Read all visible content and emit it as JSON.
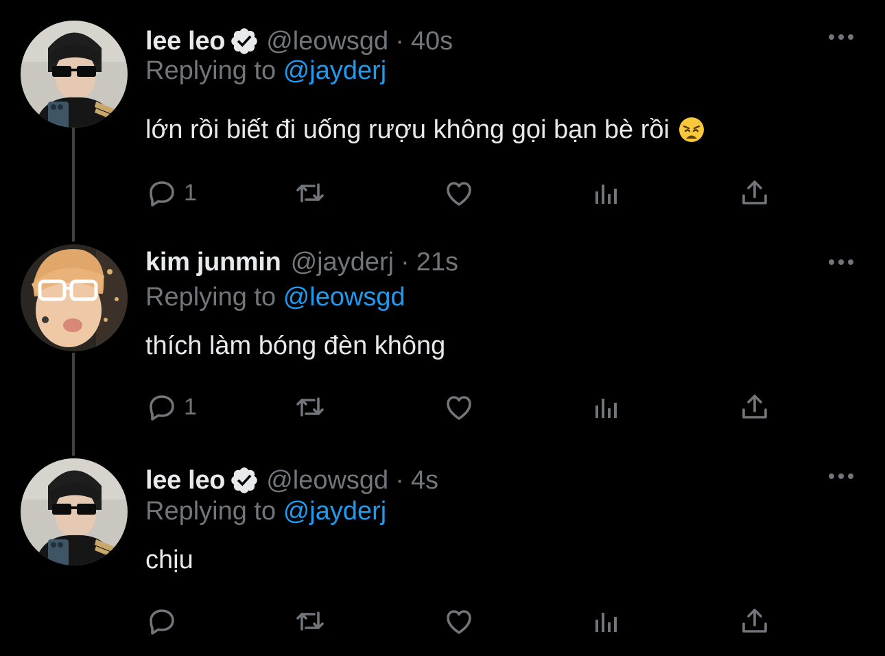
{
  "colors": {
    "background": "#000000",
    "primary_text": "#e7e9ea",
    "secondary_text": "#71767b",
    "accent": "#1d9bf0",
    "thread_line": "#3e4144"
  },
  "tweets": [
    {
      "display_name": "lee leo",
      "verified": true,
      "handle": "@leowsgd",
      "separator": "·",
      "time": "40s",
      "replying_prefix": "Replying to",
      "replying_to": "@jayderj",
      "text": "lớn rồi biết đi uống rượu không gọi bạn bè rồi",
      "emoji": "weary-face-emoji",
      "reply_count": "1",
      "icons": [
        "reply-icon",
        "retweet-icon",
        "like-icon",
        "views-icon",
        "share-icon",
        "more-icon"
      ]
    },
    {
      "display_name": "kim junmin",
      "verified": false,
      "handle": "@jayderj",
      "separator": "·",
      "time": "21s",
      "replying_prefix": "Replying to",
      "replying_to": "@leowsgd",
      "text": "thích làm bóng đèn không",
      "reply_count": "1",
      "icons": [
        "reply-icon",
        "retweet-icon",
        "like-icon",
        "views-icon",
        "share-icon",
        "more-icon"
      ]
    },
    {
      "display_name": "lee leo",
      "verified": true,
      "handle": "@leowsgd",
      "separator": "·",
      "time": "4s",
      "replying_prefix": "Replying to",
      "replying_to": "@jayderj",
      "text": "chịu",
      "reply_count": "",
      "icons": [
        "reply-icon",
        "retweet-icon",
        "like-icon",
        "views-icon",
        "share-icon",
        "more-icon"
      ]
    }
  ]
}
